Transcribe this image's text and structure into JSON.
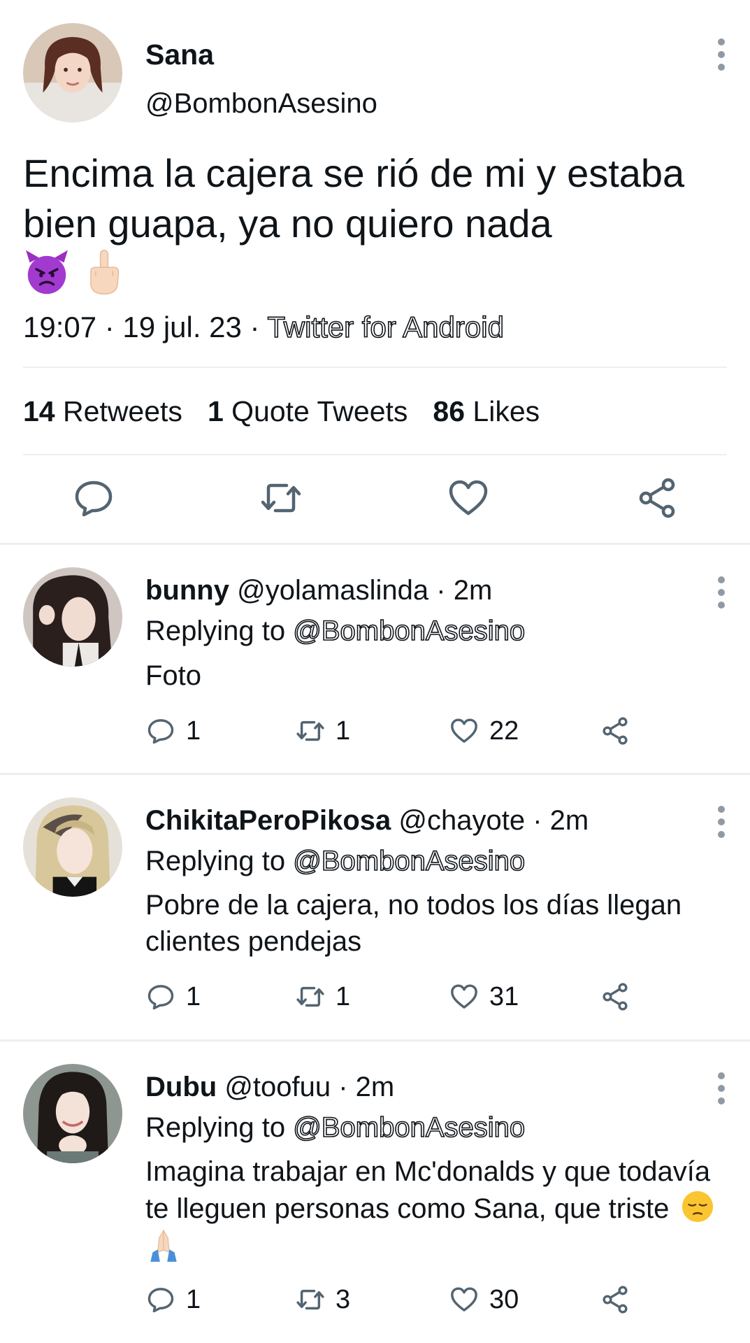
{
  "tweet": {
    "author_name": "Sana",
    "author_handle": "@BombonAsesino",
    "text": "Encima la cajera se rió de mi y estaba bien guapa, ya no quiero nada",
    "emojis": [
      "devil-face",
      "pointing-up-hand"
    ],
    "time": "19:07 · 19 jul. 23 · ",
    "source": "Twitter for Android",
    "stats": {
      "retweets_count": "14",
      "retweets_label": "Retweets",
      "quotes_count": "1",
      "quotes_label": "Quote Tweets",
      "likes_count": "86",
      "likes_label": "Likes"
    },
    "actions": [
      "reply-icon",
      "retweet-icon",
      "like-icon",
      "share-icon"
    ]
  },
  "replies": [
    {
      "name": "bunny",
      "handle": "@yolamaslinda · 2m",
      "replying_prefix": "Replying to ",
      "replying_to": "@BombonAsesino",
      "text": "Foto",
      "replies": "1",
      "retweets": "1",
      "likes": "22"
    },
    {
      "name": "ChikitaPeroPikosa",
      "handle": "@chayote · 2m",
      "replying_prefix": "Replying to ",
      "replying_to": "@BombonAsesino",
      "text": "Pobre de la cajera, no todos los días llegan clientes pendejas",
      "replies": "1",
      "retweets": "1",
      "likes": "31"
    },
    {
      "name": "Dubu",
      "handle": "@toofuu · 2m",
      "replying_prefix": "Replying to ",
      "replying_to": "@BombonAsesino",
      "text": "Imagina trabajar en Mc'donalds y que todavía te lleguen personas como Sana, que triste",
      "emojis": [
        "pensive-face",
        "folded-hands"
      ],
      "replies": "1",
      "retweets": "3",
      "likes": "30"
    }
  ],
  "colors": {
    "text": "#0f1419",
    "icon": "#536471",
    "divider": "#eceff1"
  }
}
